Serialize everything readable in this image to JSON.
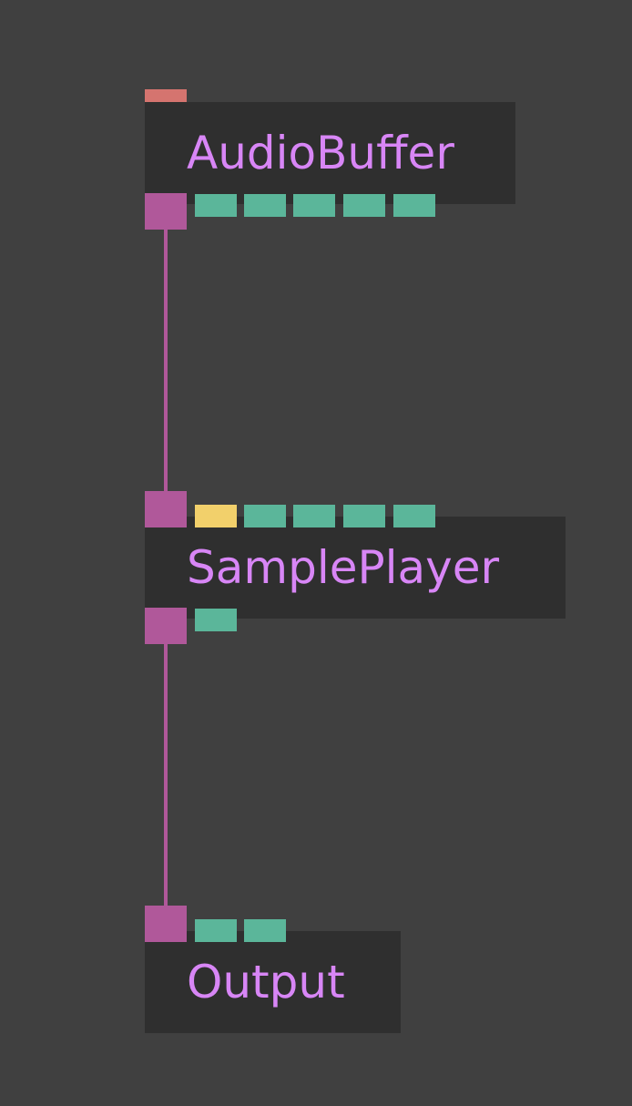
{
  "colors": {
    "background": "#404040",
    "node_body": "#2f2f2f",
    "node_title": "#d886f6",
    "wire": "#b0589a",
    "signal_port": "#b0589a",
    "control_port": "#d5746f",
    "param_port": "#5bb69a",
    "highlight_port": "#f2d06b"
  },
  "nodes": [
    {
      "id": "audiobuffer",
      "title": "AudioBuffer",
      "inlets": [
        "control-port"
      ],
      "outlets": [
        "signal-port",
        "param-port",
        "param-port",
        "param-port",
        "param-port",
        "param-port"
      ]
    },
    {
      "id": "sampleplayer",
      "title": "SamplePlayer",
      "inlets": [
        "signal-port",
        "highlight-port",
        "param-port",
        "param-port",
        "param-port",
        "param-port"
      ],
      "outlets": [
        "signal-port",
        "param-port"
      ]
    },
    {
      "id": "output",
      "title": "Output",
      "inlets": [
        "signal-port",
        "param-port",
        "param-port"
      ],
      "outlets": []
    }
  ],
  "connections": [
    {
      "from": "audiobuffer",
      "to": "sampleplayer"
    },
    {
      "from": "sampleplayer",
      "to": "output"
    }
  ]
}
